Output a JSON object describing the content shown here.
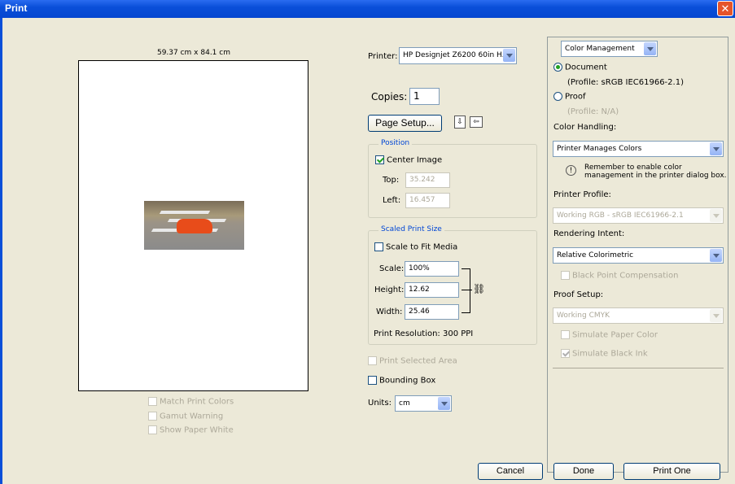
{
  "window": {
    "title": "Print",
    "close_symbol": "✕"
  },
  "preview": {
    "paper_size": "59.37 cm x 84.1 cm"
  },
  "left_options": {
    "match_print_colors": "Match Print Colors",
    "gamut_warning": "Gamut Warning",
    "show_paper_white": "Show Paper White"
  },
  "printer": {
    "label": "Printer:",
    "value": "HP Designjet Z6200 60in H..."
  },
  "copies": {
    "label": "Copies:",
    "value": "1"
  },
  "page_setup": {
    "label": "Page Setup..."
  },
  "position": {
    "legend": "Position",
    "center_image": "Center Image",
    "top_label": "Top:",
    "top_value": "35.242",
    "left_label": "Left:",
    "left_value": "16.457"
  },
  "scaled": {
    "legend": "Scaled Print Size",
    "scale_to_fit": "Scale to Fit Media",
    "scale_label": "Scale:",
    "scale_value": "100%",
    "height_label": "Height:",
    "height_value": "12.62",
    "width_label": "Width:",
    "width_value": "25.46",
    "resolution": "Print Resolution: 300 PPI"
  },
  "print_selected_area": "Print Selected Area",
  "bounding_box": "Bounding Box",
  "units": {
    "label": "Units:",
    "value": "cm"
  },
  "color_mgmt": {
    "dropdown": "Color Management",
    "document": "Document",
    "document_profile": "(Profile: sRGB IEC61966-2.1)",
    "proof": "Proof",
    "proof_profile": "(Profile: N/A)",
    "color_handling_label": "Color Handling:",
    "color_handling_value": "Printer Manages Colors",
    "reminder": "Remember to enable color management in the printer dialog box.",
    "printer_profile_label": "Printer Profile:",
    "printer_profile_value": "Working RGB - sRGB IEC61966-2.1",
    "rendering_intent_label": "Rendering Intent:",
    "rendering_intent_value": "Relative Colorimetric",
    "black_point": "Black Point Compensation",
    "proof_setup_label": "Proof Setup:",
    "proof_setup_value": "Working CMYK",
    "simulate_paper": "Simulate Paper Color",
    "simulate_black": "Simulate Black Ink"
  },
  "buttons": {
    "cancel": "Cancel",
    "done": "Done",
    "print_one": "Print One"
  }
}
